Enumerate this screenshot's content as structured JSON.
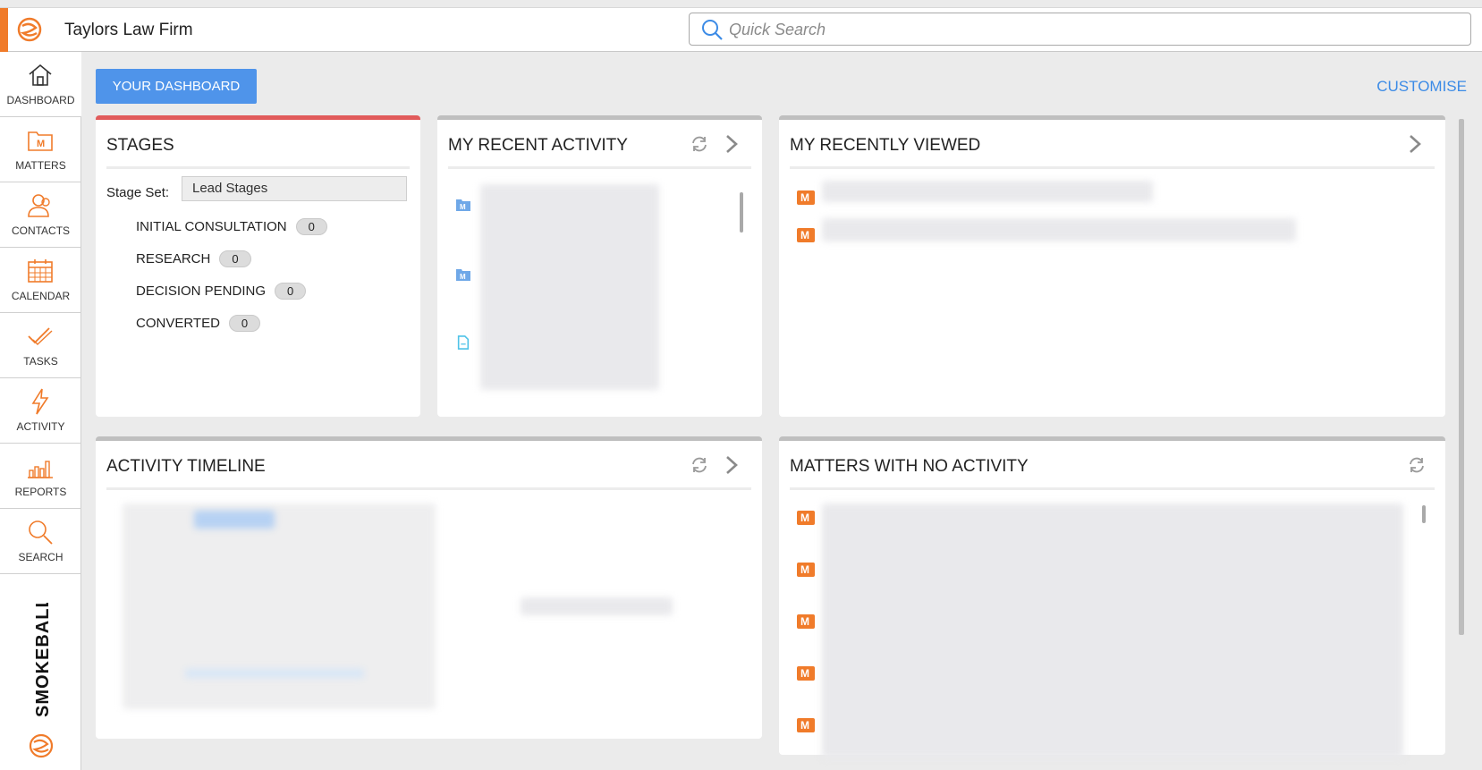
{
  "app": {
    "firm_name": "Taylors Law Firm"
  },
  "search": {
    "placeholder": "Quick Search"
  },
  "sidebar": {
    "items": [
      {
        "label": "DASHBOARD",
        "icon": "home-icon"
      },
      {
        "label": "MATTERS",
        "icon": "matters-icon"
      },
      {
        "label": "CONTACTS",
        "icon": "contacts-icon"
      },
      {
        "label": "CALENDAR",
        "icon": "calendar-icon"
      },
      {
        "label": "TASKS",
        "icon": "tasks-icon"
      },
      {
        "label": "ACTIVITY",
        "icon": "activity-icon"
      },
      {
        "label": "REPORTS",
        "icon": "reports-icon"
      },
      {
        "label": "SEARCH",
        "icon": "search-icon"
      }
    ],
    "brand": "SMOKEBALL"
  },
  "toolbar": {
    "dashboard_label": "YOUR DASHBOARD",
    "customise_label": "CUSTOMISE"
  },
  "stages": {
    "title": "STAGES",
    "stage_set_label": "Stage Set:",
    "stage_set_value": "Lead Stages",
    "rows": [
      {
        "label": "INITIAL CONSULTATION",
        "count": "0"
      },
      {
        "label": "RESEARCH",
        "count": "0"
      },
      {
        "label": "DECISION PENDING",
        "count": "0"
      },
      {
        "label": "CONVERTED",
        "count": "0"
      }
    ]
  },
  "recent_activity": {
    "title": "MY RECENT ACTIVITY"
  },
  "recently_viewed": {
    "title": "MY RECENTLY VIEWED"
  },
  "activity_timeline": {
    "title": "ACTIVITY TIMELINE"
  },
  "no_activity": {
    "title": "MATTERS WITH NO ACTIVITY"
  },
  "colors": {
    "accent": "#f07b2a",
    "primary": "#4f94ea",
    "link": "#3c8be6",
    "stages_bar": "#e15b5b"
  }
}
